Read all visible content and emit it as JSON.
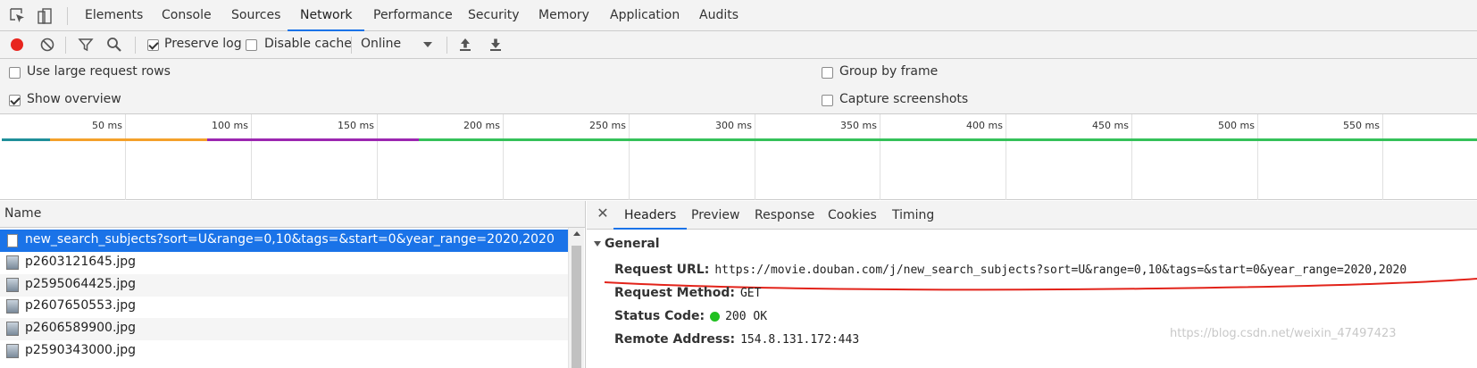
{
  "tabbar": {
    "tabs": [
      {
        "label": "Elements"
      },
      {
        "label": "Console"
      },
      {
        "label": "Sources"
      },
      {
        "label": "Network"
      },
      {
        "label": "Performance"
      },
      {
        "label": "Security"
      },
      {
        "label": "Memory"
      },
      {
        "label": "Application"
      },
      {
        "label": "Audits"
      }
    ],
    "active_tab": "Network",
    "icons": [
      "inspect-element-icon",
      "device-toolbar-icon"
    ]
  },
  "toolbar": {
    "record_color": "#e8251e",
    "preserve_log": {
      "label": "Preserve log",
      "checked": true
    },
    "disable_cache": {
      "label": "Disable cache",
      "checked": false
    },
    "throttling": "Online",
    "icons": [
      "record-icon",
      "clear-icon",
      "filter-icon",
      "search-icon",
      "chevron-down-icon",
      "import-har-icon",
      "export-har-icon"
    ]
  },
  "settings": {
    "large_rows": {
      "label": "Use large request rows",
      "checked": false
    },
    "show_overview": {
      "label": "Show overview",
      "checked": true
    },
    "group_by_frame": {
      "label": "Group by frame",
      "checked": false
    },
    "capture_screenshots": {
      "label": "Capture screenshots",
      "checked": false
    }
  },
  "overview": {
    "ticks": [
      "50 ms",
      "100 ms",
      "150 ms",
      "200 ms",
      "250 ms",
      "300 ms",
      "350 ms",
      "400 ms",
      "450 ms",
      "500 ms",
      "550 ms"
    ],
    "colors": {
      "teal": "#1f8f9a",
      "orange": "#f4a12b",
      "purple": "#9c27b0",
      "green": "#35c15a"
    }
  },
  "requests": {
    "column_header": "Name",
    "rows": [
      {
        "name": "new_search_subjects?sort=U&range=0,10&tags=&start=0&year_range=2020,2020",
        "selected": true,
        "type": "document"
      },
      {
        "name": "p2603121645.jpg",
        "selected": false,
        "type": "image"
      },
      {
        "name": "p2595064425.jpg",
        "selected": false,
        "type": "image"
      },
      {
        "name": "p2607650553.jpg",
        "selected": false,
        "type": "image"
      },
      {
        "name": "p2606589900.jpg",
        "selected": false,
        "type": "image"
      },
      {
        "name": "p2590343000.jpg",
        "selected": false,
        "type": "image"
      }
    ]
  },
  "details": {
    "tabs": [
      {
        "label": "Headers"
      },
      {
        "label": "Preview"
      },
      {
        "label": "Response"
      },
      {
        "label": "Cookies"
      },
      {
        "label": "Timing"
      }
    ],
    "active_tab": "Headers",
    "section_title": "General",
    "request_url": {
      "key": "Request URL:",
      "value": "https://movie.douban.com/j/new_search_subjects?sort=U&range=0,10&tags=&start=0&year_range=2020,2020"
    },
    "request_method": {
      "key": "Request Method:",
      "value": "GET"
    },
    "status_code": {
      "key": "Status Code:",
      "value": "200 OK",
      "color": "#20c020"
    },
    "remote_address": {
      "key": "Remote Address:",
      "value": "154.8.131.172:443"
    },
    "annotation_color": "#e2231a"
  },
  "watermark": "https://blog.csdn.net/weixin_47497423"
}
